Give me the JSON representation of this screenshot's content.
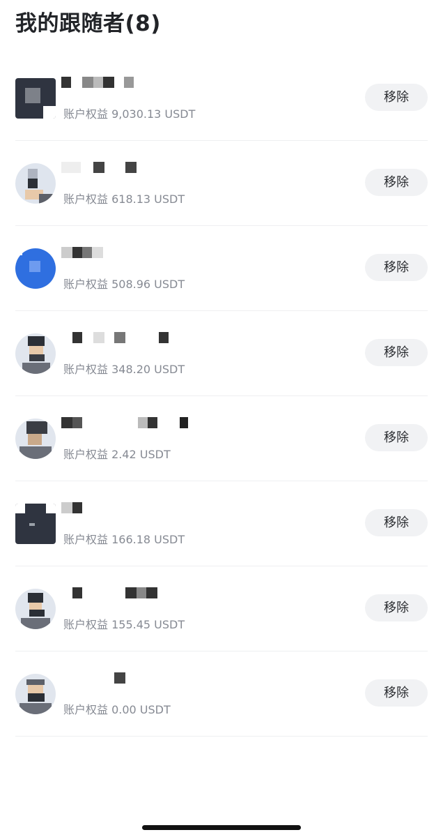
{
  "header": {
    "title": "我的跟随者(8)"
  },
  "followers": [
    {
      "equity_text": "账户权益 9,030.13 USDT",
      "remove_label": "移除"
    },
    {
      "equity_text": "账户权益 618.13 USDT",
      "remove_label": "移除"
    },
    {
      "equity_text": "账户权益 508.96 USDT",
      "remove_label": "移除"
    },
    {
      "equity_text": "账户权益 348.20 USDT",
      "remove_label": "移除"
    },
    {
      "equity_text": "账户权益 2.42 USDT",
      "remove_label": "移除"
    },
    {
      "equity_text": "账户权益 166.18 USDT",
      "remove_label": "移除"
    },
    {
      "equity_text": "账户权益 155.45 USDT",
      "remove_label": "移除"
    },
    {
      "equity_text": "账户权益 0.00 USDT",
      "remove_label": "移除"
    }
  ]
}
